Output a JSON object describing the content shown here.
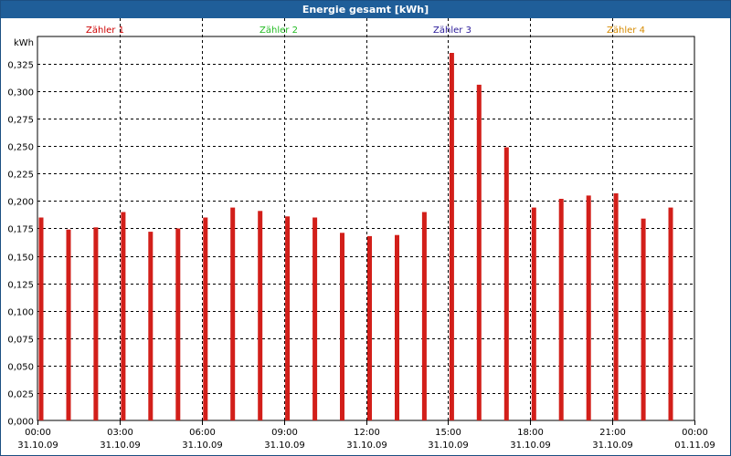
{
  "window": {
    "title": "Energie gesamt [kWh]"
  },
  "chart_data": {
    "type": "bar",
    "title": "Energie gesamt [kWh]",
    "ylabel": "kWh",
    "xlabel": "",
    "ylim": [
      0,
      0.35
    ],
    "yticks": [
      "0,000",
      "0,025",
      "0,050",
      "0,075",
      "0,100",
      "0,125",
      "0,150",
      "0,175",
      "0,200",
      "0,225",
      "0,250",
      "0,275",
      "0,300",
      "0,325"
    ],
    "xticks": [
      {
        "time": "00:00",
        "date": "31.10.09"
      },
      {
        "time": "03:00",
        "date": "31.10.09"
      },
      {
        "time": "06:00",
        "date": "31.10.09"
      },
      {
        "time": "09:00",
        "date": "31.10.09"
      },
      {
        "time": "12:00",
        "date": "31.10.09"
      },
      {
        "time": "15:00",
        "date": "31.10.09"
      },
      {
        "time": "18:00",
        "date": "31.10.09"
      },
      {
        "time": "21:00",
        "date": "31.10.09"
      },
      {
        "time": "00:00",
        "date": "01.11.09"
      }
    ],
    "legend": [
      {
        "name": "Zähler 1",
        "color": "#cc0000"
      },
      {
        "name": "Zähler 2",
        "color": "#22bb22"
      },
      {
        "name": "Zähler 3",
        "color": "#2a1a99"
      },
      {
        "name": "Zähler 4",
        "color": "#d68a00"
      }
    ],
    "grid": true,
    "bar_color": "#d21f1a",
    "series": [
      {
        "name": "Zähler 1",
        "values": [
          0.185,
          0.174,
          0.176,
          0.19,
          0.172,
          0.175,
          0.185,
          0.194,
          0.191,
          0.186,
          0.185,
          0.171,
          0.168,
          0.169,
          0.19,
          0.335,
          0.306,
          0.249,
          0.194,
          0.202,
          0.205,
          0.207,
          0.184,
          0.194
        ]
      }
    ]
  }
}
